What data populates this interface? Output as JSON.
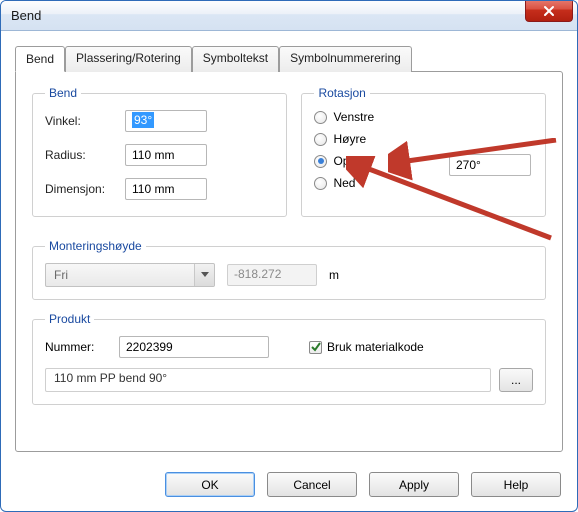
{
  "window": {
    "title": "Bend"
  },
  "tabs": [
    {
      "label": "Bend"
    },
    {
      "label": "Plassering/Rotering"
    },
    {
      "label": "Symboltekst"
    },
    {
      "label": "Symbolnummerering"
    }
  ],
  "bend_group": {
    "legend": "Bend",
    "angle_label": "Vinkel:",
    "angle_value": "93°",
    "radius_label": "Radius:",
    "radius_value": "110 mm",
    "dim_label": "Dimensjon:",
    "dim_value": "110 mm"
  },
  "rotation_group": {
    "legend": "Rotasjon",
    "options": {
      "left": "Venstre",
      "right": "Høyre",
      "up": "Opp",
      "down": "Ned"
    },
    "selected": "up",
    "value": "270°"
  },
  "mount_group": {
    "legend": "Monteringshøyde",
    "combo_value": "Fri",
    "height_value": "-818.272",
    "unit": "m"
  },
  "product_group": {
    "legend": "Produkt",
    "number_label": "Nummer:",
    "number_value": "2202399",
    "use_matcode_label": "Bruk materialkode",
    "use_matcode_checked": true,
    "description": "110 mm PP bend 90°",
    "browse_label": "..."
  },
  "buttons": {
    "ok": "OK",
    "cancel": "Cancel",
    "apply": "Apply",
    "help": "Help"
  }
}
